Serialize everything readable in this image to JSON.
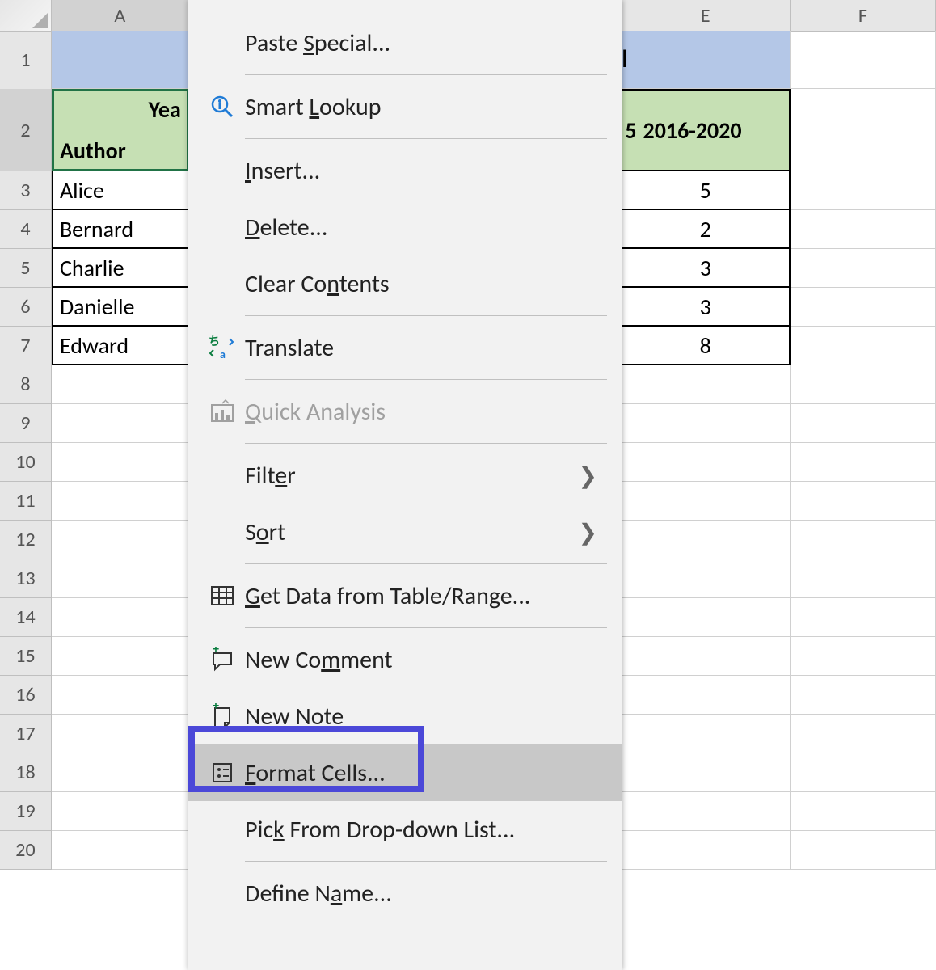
{
  "columns": {
    "A": "A",
    "E": "E",
    "F": "F"
  },
  "rows": [
    "1",
    "2",
    "3",
    "4",
    "5",
    "6",
    "7",
    "8",
    "9",
    "10",
    "11",
    "12",
    "13",
    "14",
    "15",
    "16",
    "17",
    "18",
    "19",
    "20"
  ],
  "row1": {
    "e_fragment": "l"
  },
  "row2": {
    "a_top": "Yea",
    "a_bottom": "Author",
    "e_fragment": "5",
    "e_label": "2016-2020"
  },
  "data": {
    "authors": [
      "Alice",
      "Bernard",
      "Charlie",
      "Danielle",
      "Edward"
    ],
    "e_values": [
      "5",
      "2",
      "3",
      "3",
      "8"
    ]
  },
  "menu": {
    "paste_special": "Paste Special...",
    "smart_lookup": "Smart Lookup",
    "insert": "Insert...",
    "delete": "Delete...",
    "clear_contents": "Clear Contents",
    "translate": "Translate",
    "quick_analysis": "Quick Analysis",
    "filter": "Filter",
    "sort": "Sort",
    "get_data": "Get Data from Table/Range...",
    "new_comment": "New Comment",
    "new_note": "New Note",
    "format_cells": "Format Cells...",
    "pick_list": "Pick From Drop-down List...",
    "define_name": "Define Name..."
  }
}
